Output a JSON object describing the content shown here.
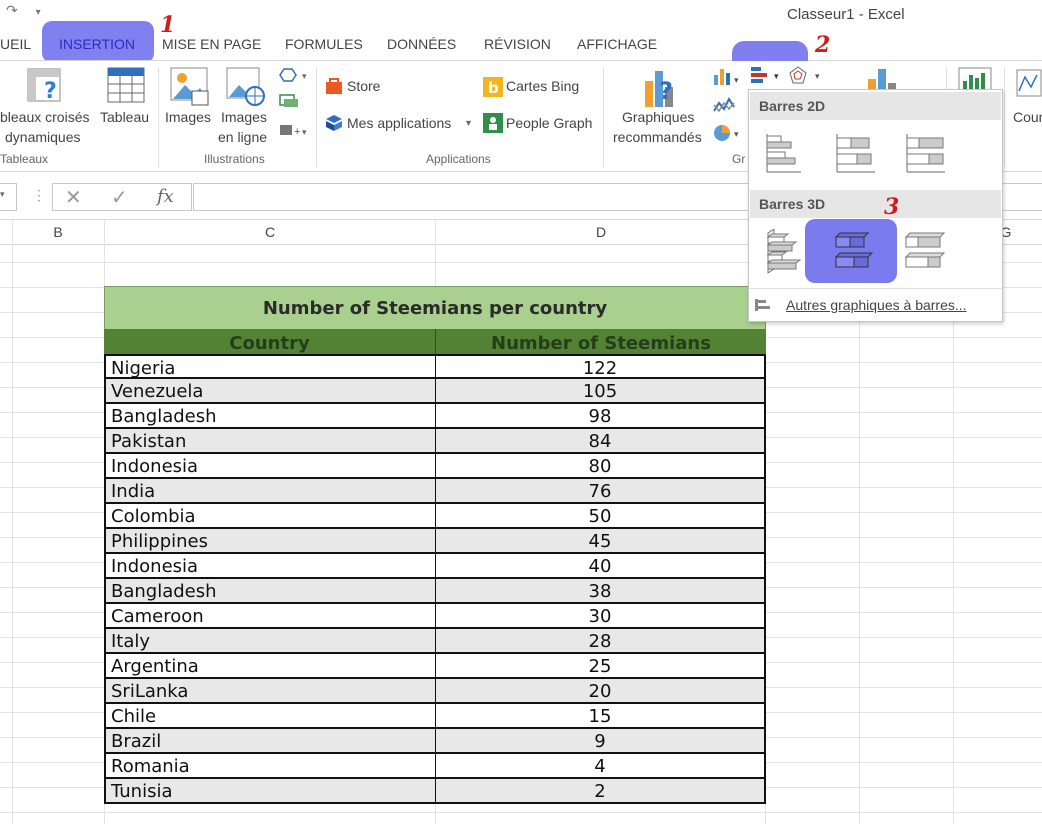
{
  "window": {
    "title": "Classeur1 - Excel"
  },
  "tabs": {
    "accueil": "UEIL",
    "insertion": "INSERTION",
    "mise_en_page": "MISE EN PAGE",
    "formules": "FORMULES",
    "donnees": "DONNÉES",
    "revision": "RÉVISION",
    "affichage": "AFFICHAGE"
  },
  "markers": {
    "one": "1",
    "two": "2",
    "three": "3"
  },
  "ribbon": {
    "tableaux": {
      "tcd_line1": "bleaux croisés",
      "tcd_line2": "dynamiques",
      "tableau": "Tableau",
      "group": "Tableaux"
    },
    "illustrations": {
      "images": "Images",
      "images_en_ligne_1": "Images",
      "images_en_ligne_2": "en ligne",
      "group": "Illustrations"
    },
    "applications": {
      "store": "Store",
      "mes_applications": "Mes applications",
      "cartes_bing": "Cartes Bing",
      "people_graph": "People Graph",
      "group": "Applications"
    },
    "graphiques": {
      "recommandes_1": "Graphiques",
      "recommandes_2": "recommandés",
      "group": "Gr"
    },
    "cour": "Cour"
  },
  "formula_bar": {
    "cancel": "✕",
    "enter": "✓",
    "fx": "fx"
  },
  "columns": [
    "B",
    "C",
    "D",
    "G"
  ],
  "dropdown": {
    "section_2d": "Barres 2D",
    "section_3d": "Barres 3D",
    "more": "Autres graphiques à barres..."
  },
  "colors": {
    "highlight": "#7f7fef",
    "marker": "#d01c1c",
    "title_fill": "#a9d08e",
    "header_fill": "#548235",
    "row_alt": "#e8e8e8"
  },
  "table": {
    "title": "Number of Steemians per country",
    "headers": [
      "Country",
      "Number of Steemians"
    ],
    "rows": [
      [
        "Nigeria",
        "122"
      ],
      [
        "Venezuela",
        "105"
      ],
      [
        "Bangladesh",
        "98"
      ],
      [
        "Pakistan",
        "84"
      ],
      [
        "Indonesia",
        "80"
      ],
      [
        "India",
        "76"
      ],
      [
        "Colombia",
        "50"
      ],
      [
        "Philippines",
        "45"
      ],
      [
        "Indonesia",
        "40"
      ],
      [
        "Bangladesh",
        "38"
      ],
      [
        "Cameroon",
        "30"
      ],
      [
        "Italy",
        "28"
      ],
      [
        "Argentina",
        "25"
      ],
      [
        "SriLanka",
        "20"
      ],
      [
        "Chile",
        "15"
      ],
      [
        "Brazil",
        "9"
      ],
      [
        "Romania",
        "4"
      ],
      [
        "Tunisia",
        "2"
      ]
    ]
  }
}
